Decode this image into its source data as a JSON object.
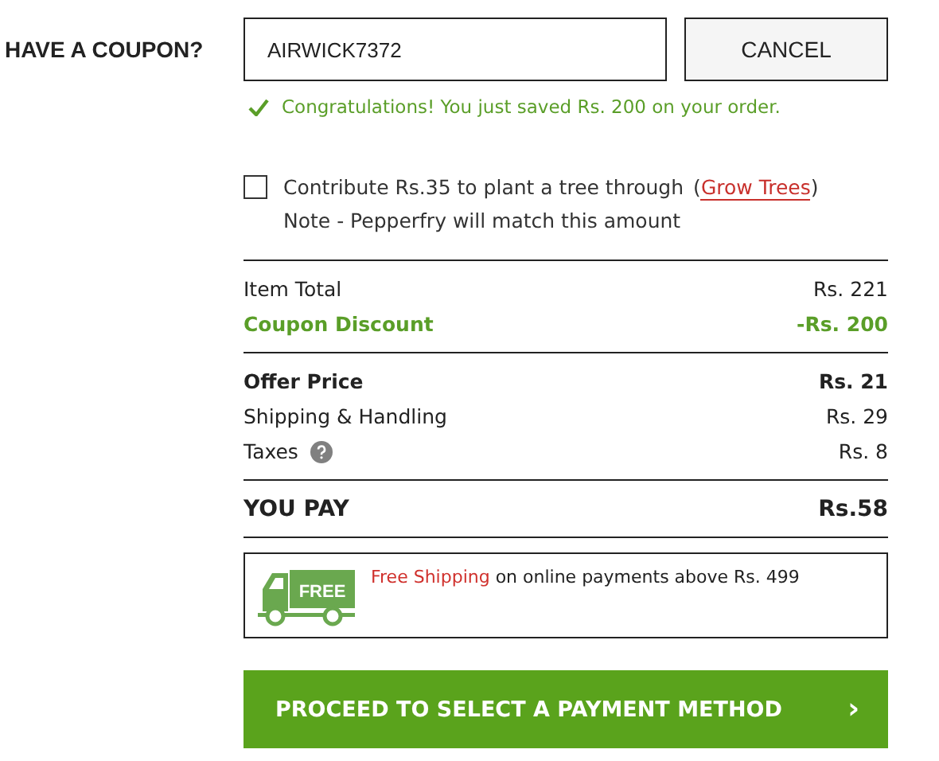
{
  "coupon": {
    "label": "HAVE A COUPON?",
    "value": "AIRWICK7372",
    "cancel": "CANCEL",
    "success": "Congratulations! You just saved Rs.  200 on your order."
  },
  "donation": {
    "checked": false,
    "text": "Contribute Rs.35 to plant a tree through",
    "open": "(",
    "link": "Grow Trees",
    "close": ")",
    "note": "Note - Pepperfry will match this amount"
  },
  "summary": [
    {
      "rows": [
        {
          "kind": "normal",
          "label": "Item Total",
          "value": "Rs. 221",
          "help": false
        },
        {
          "kind": "discount",
          "label": "Coupon Discount",
          "value": "-Rs. 200",
          "help": false
        }
      ]
    },
    {
      "rows": [
        {
          "kind": "bold",
          "label": "Offer Price",
          "value": "Rs. 21",
          "help": false
        },
        {
          "kind": "normal",
          "label": "Shipping & Handling",
          "value": "Rs. 29",
          "help": false
        },
        {
          "kind": "normal",
          "label": "Taxes",
          "value": "Rs. 8",
          "help": true
        }
      ]
    },
    {
      "rows": [
        {
          "kind": "total",
          "label": "YOU PAY",
          "value": "Rs.58",
          "help": false
        }
      ]
    }
  ],
  "shipping": {
    "badge": "FREE",
    "highlight": "Free Shipping",
    "text": "on online payments above Rs. 499"
  },
  "proceed": {
    "label": "PROCEED TO SELECT A PAYMENT METHOD",
    "arrow": "›"
  }
}
